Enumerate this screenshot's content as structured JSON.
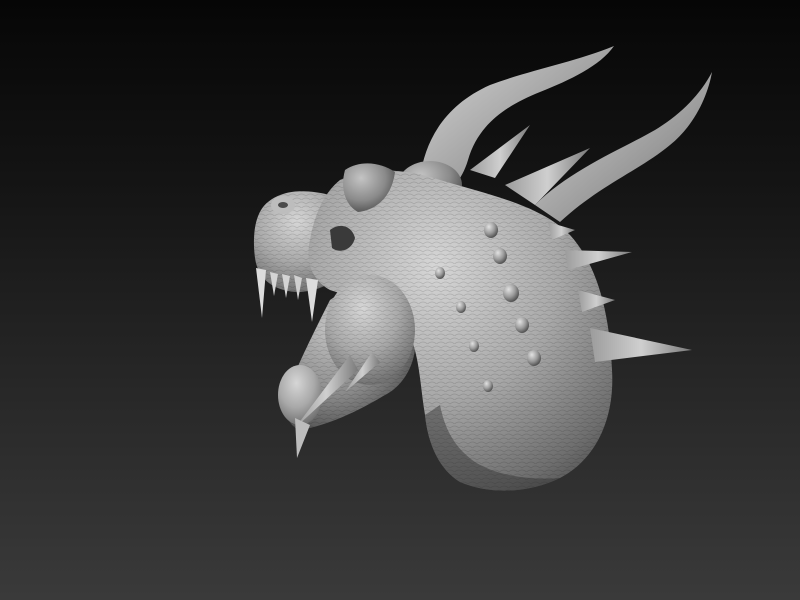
{
  "viewport": {
    "background_top": "#060606",
    "background_bottom": "#3a3a3a",
    "model": {
      "icon": "dragon-head-sculpt",
      "material_light": "#d2d2d2",
      "material_mid": "#8e8e8e",
      "material_dark": "#3c3c3c"
    }
  }
}
